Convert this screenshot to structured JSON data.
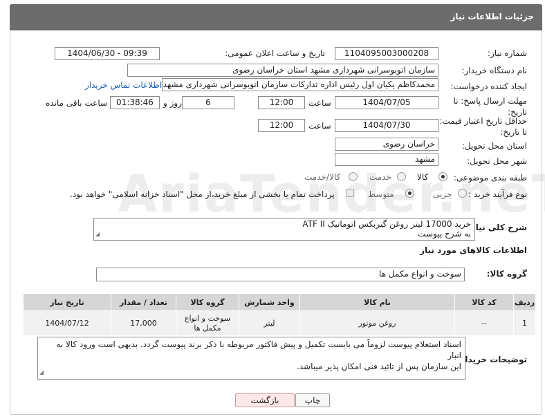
{
  "header": {
    "title": "جزئیات اطلاعات نیاز"
  },
  "watermark": {
    "text": "AriaTender.neT"
  },
  "need": {
    "number_label": "شماره نیاز:",
    "number": "1104095003000208",
    "announce_label": "تاریخ و ساعت اعلان عمومی:",
    "announce": "1404/06/30 - 09:39",
    "buyer_org_label": "نام دستگاه خریدار:",
    "buyer_org": "سازمان اتوبوسرانی شهرداری مشهد استان خراسان رضوی",
    "creator_label": "ایجاد کننده درخواست:",
    "creator": "محمدکاظم یکیان اول رئیس اداره تدارکات سازمان اتوبوسرانی شهرداری مشهد ا",
    "contact_link": "اطلاعات تماس خریدار",
    "reply_deadline_label": "مهلت ارسال پاسخ: تا تاریخ:",
    "reply_date": "1404/07/05",
    "time_label": "ساعت",
    "reply_time": "12:00",
    "days": "6",
    "days_label": "روز و",
    "remaining": "01:38:46",
    "remaining_label": "ساعت باقی مانده",
    "price_validity_label": "حداقل تاریخ اعتبار قیمت: تا تاریخ:",
    "price_date": "1404/07/30",
    "price_time": "12:00",
    "province_label": "استان محل تحویل:",
    "province": "خراسان رضوی",
    "city_label": "شهر محل تحویل:",
    "city": "مشهد",
    "category_label": "طبقه بندی موضوعی:",
    "category_options": [
      "کالا",
      "خدمت",
      "کالا/خدمت"
    ],
    "category_selected": "کالا",
    "process_label": "نوع فرآیند خرید :",
    "process_options": [
      "جزیی",
      "متوسط"
    ],
    "process_selected": "متوسط",
    "payment_note": "پرداخت تمام یا بخشی از مبلغ خرید،از محل \"اسناد خزانه اسلامی\" خواهد بود."
  },
  "summary": {
    "label": "شرح کلی نیاز:",
    "line1": "خرید 17000 لیتر روغن گیربکس اتوماتیک ATF II",
    "line2": "به شرح پیوست"
  },
  "goods": {
    "section_title": "اطلاعات کالاهای مورد نیاز",
    "group_label": "گروه کالا:",
    "group": "سوخت و انواع مکمل ها",
    "columns": [
      "ردیف",
      "کد کالا",
      "نام کالا",
      "واحد شمارش",
      "گروه کالا",
      "تعداد / مقدار",
      "تاریخ نیاز"
    ],
    "rows": [
      {
        "row": "1",
        "code": "--",
        "name": "روغن موتور",
        "unit": "لیتر",
        "group": "سوخت و انواع مکمل ها",
        "qty": "17,000",
        "date": "1404/07/12"
      }
    ]
  },
  "buyer_notes": {
    "label": "توضیحات خریدار:",
    "line1": "اسناد استعلام پیوست لزوماً می بایست تکمیل و پیش فاکتور مربوطه با ذکر برند پیوست گردد. بدیهی است ورود کالا به انبار",
    "line2": "این سازمان پس از تائید فنی امکان پذیر میباشد."
  },
  "actions": {
    "print": "چاپ",
    "back": "بازگشت"
  }
}
